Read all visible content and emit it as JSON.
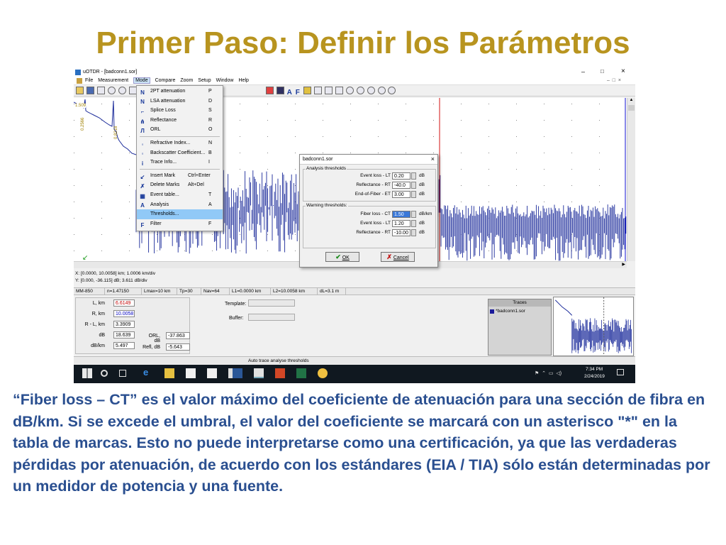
{
  "slide": {
    "title": "Primer Paso: Definir los Parámetros",
    "body": "“Fiber loss – CT” es el valor máximo del coeficiente de atenuación para una sección de fibra en dB/km. Si se excede el umbral, el valor del coeficiente se marcará con un asterisco \"*\" en la tabla de marcas. Esto no puede interpretarse como una certificación, ya que las verdaderas pérdidas por atenuación, de acuerdo con los estándares (EIA / TIA) sólo están determinadas por un medidor de potencia y una fuente."
  },
  "window": {
    "title": "uOTDR - [badconn1.sor]",
    "minimize": "–",
    "maximize": "□",
    "close": "×"
  },
  "menubar": [
    "File",
    "Measurement",
    "Mode",
    "Compare",
    "Zoom",
    "Setup",
    "Window",
    "Help"
  ],
  "mode_menu": [
    {
      "label": "2PT attenuation",
      "shortcut": "P",
      "icon": "2pt-icon",
      "glyph": "N"
    },
    {
      "label": "LSA attenuation",
      "shortcut": "D",
      "icon": "lsa-icon",
      "glyph": "N"
    },
    {
      "label": "Splice Loss",
      "shortcut": "S",
      "icon": "splice-icon",
      "glyph": "⌐"
    },
    {
      "label": "Reflectance",
      "shortcut": "R",
      "icon": "reflectance-icon",
      "glyph": "⋔"
    },
    {
      "label": "ORL",
      "shortcut": "O",
      "icon": "orl-icon",
      "glyph": "Л"
    },
    {
      "label": "Refractive Index...",
      "shortcut": "N",
      "icon": "refractive-icon",
      "glyph": "◦"
    },
    {
      "label": "Backscatter Coefficient...",
      "shortcut": "B",
      "icon": "backscatter-icon",
      "glyph": "◦"
    },
    {
      "label": "Trace Info...",
      "shortcut": "I",
      "icon": "info-icon",
      "glyph": "i"
    },
    {
      "label": "Insert Mark",
      "shortcut": "Ctrl+Enter",
      "icon": "insert-mark-icon",
      "glyph": "↙"
    },
    {
      "label": "Delete Marks",
      "shortcut": "Alt+Del",
      "icon": "delete-marks-icon",
      "glyph": "✗"
    },
    {
      "label": "Event table...",
      "shortcut": "T",
      "icon": "table-icon",
      "glyph": "▦"
    },
    {
      "label": "Analysis",
      "shortcut": "A",
      "icon": "analysis-icon",
      "glyph": "A"
    },
    {
      "label": "Thresholds...",
      "shortcut": "",
      "icon": "",
      "glyph": ""
    },
    {
      "label": "Filter",
      "shortcut": "F",
      "icon": "filter-icon",
      "glyph": "F"
    }
  ],
  "dialog": {
    "title": "badconn1.sor",
    "analysis_group": "Analysis thresholds",
    "warning_group": "Warning thresholds:",
    "rows": [
      {
        "label": "Event loss - LT",
        "value": "0.20",
        "unit": "dB"
      },
      {
        "label": "Reflectance - RT",
        "value": "-40.0",
        "unit": "dB"
      },
      {
        "label": "End-of-Fiber - ET",
        "value": "3.00",
        "unit": "dB"
      },
      {
        "label": "Fiber loss - CT",
        "value": "1.50",
        "unit": "dB/km"
      },
      {
        "label": "Event loss - LT",
        "value": "1.20",
        "unit": "dB"
      },
      {
        "label": "Reflectance - RT",
        "value": "-10.00",
        "unit": "dB"
      }
    ],
    "ok": "OK",
    "cancel": "Cancel"
  },
  "chart_labels": {
    "top": "1.509",
    "v1": "0.2566",
    "v2": "0.8218"
  },
  "coords": {
    "x": "X: [0.0000, 10.0058] km; 1.0006 km/div",
    "y": "Y: [0.000, -36.115] dB; 3.611 dB/div"
  },
  "params": [
    "MM-850",
    "n=1.47150",
    "Lmax=10 km",
    "Tp=30",
    "Nav=64",
    "L1=0.0000 km",
    "L2=10.0058 km",
    "dL=3.1 m"
  ],
  "measure": [
    {
      "label": "L, km",
      "value": "6.6149",
      "color": "#c00000"
    },
    {
      "label": "R, km",
      "value": "10.0058",
      "color": "#0000c0"
    },
    {
      "label": "R - L, km",
      "value": "3.3909",
      "color": "#000000"
    },
    {
      "label": "dB",
      "value": "18.639",
      "color": "#000000"
    },
    {
      "label": "dB/km",
      "value": "5.497",
      "color": "#000000"
    }
  ],
  "orl": {
    "orl_label": "ORL, dB",
    "orl_value": "-37.863",
    "refl_label": "Refl, dB",
    "refl_value": "-5.643"
  },
  "template_label": "Template:",
  "buffer_label": "Buffer:",
  "traces": {
    "title": "Traces",
    "item": "*badconn1.sor"
  },
  "status": "Auto trace analyse thresholds",
  "taskbar": {
    "time": "7:34 PM",
    "date": "2/24/2019"
  }
}
